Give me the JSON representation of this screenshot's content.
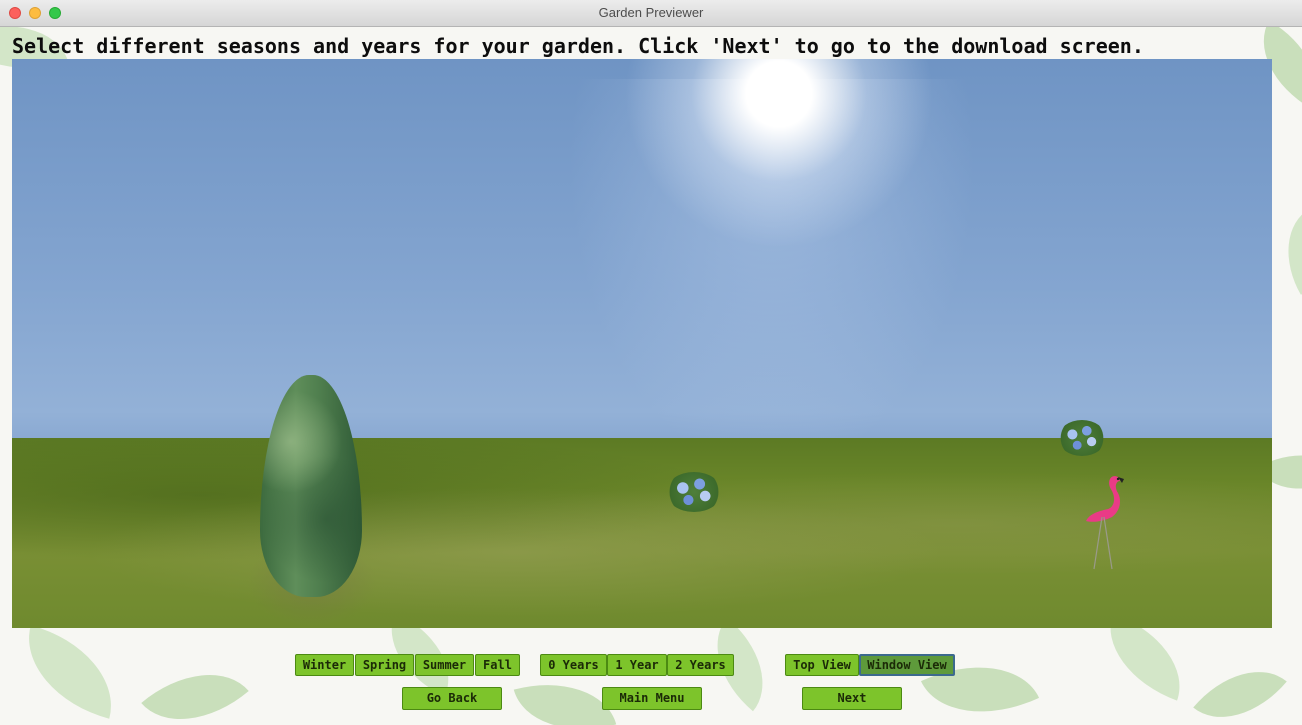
{
  "window": {
    "title": "Garden Previewer"
  },
  "instructions": "Select different seasons and years for your garden. Click 'Next' to go to the download screen.",
  "seasons": [
    "Winter",
    "Spring",
    "Summer",
    "Fall"
  ],
  "years": [
    "0 Years",
    "1 Year",
    "2 Years"
  ],
  "views": {
    "top": "Top View",
    "window": "Window View",
    "selected": "Window View"
  },
  "navigation": {
    "back": "Go Back",
    "main_menu": "Main Menu",
    "next": "Next"
  },
  "colors": {
    "button_green": "#7dc42b",
    "sky": "#7fa1cc",
    "grass": "#6a8629"
  }
}
